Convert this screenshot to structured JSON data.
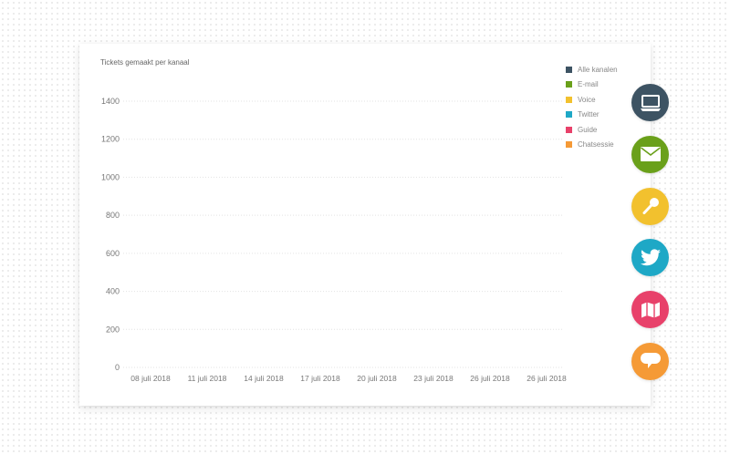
{
  "chart_data": {
    "type": "line",
    "title": "Tickets gemaakt per kanaal",
    "xlabel": "",
    "ylabel": "",
    "ylim": [
      0,
      1400
    ],
    "yticks": [
      0,
      200,
      400,
      600,
      800,
      1000,
      1200,
      1400
    ],
    "x_tick_labels": [
      "08 juli 2018",
      "11 juli 2018",
      "14 juli 2018",
      "17 juli 2018",
      "20 juli 2018",
      "23 juli 2018",
      "26 juli 2018",
      "26 juli 2018"
    ],
    "grid": true,
    "legend_position": "top-right",
    "series": [
      {
        "name": "Alle kanalen",
        "color": "#3d5363",
        "values": []
      },
      {
        "name": "E-mail",
        "color": "#6aa01a",
        "values": []
      },
      {
        "name": "Voice",
        "color": "#f2c12e",
        "values": []
      },
      {
        "name": "Twitter",
        "color": "#1ea8c6",
        "values": []
      },
      {
        "name": "Guide",
        "color": "#e8416a",
        "values": []
      },
      {
        "name": "Chatsessie",
        "color": "#f59a36",
        "values": []
      }
    ]
  },
  "channel_buttons": [
    {
      "icon": "laptop-icon",
      "color": "#3d5363"
    },
    {
      "icon": "envelope-icon",
      "color": "#6aa01a"
    },
    {
      "icon": "microphone-icon",
      "color": "#f2c12e"
    },
    {
      "icon": "twitter-bird-icon",
      "color": "#1ea8c6"
    },
    {
      "icon": "map-icon",
      "color": "#e8416a"
    },
    {
      "icon": "chat-bubble-icon",
      "color": "#f59a36"
    }
  ]
}
